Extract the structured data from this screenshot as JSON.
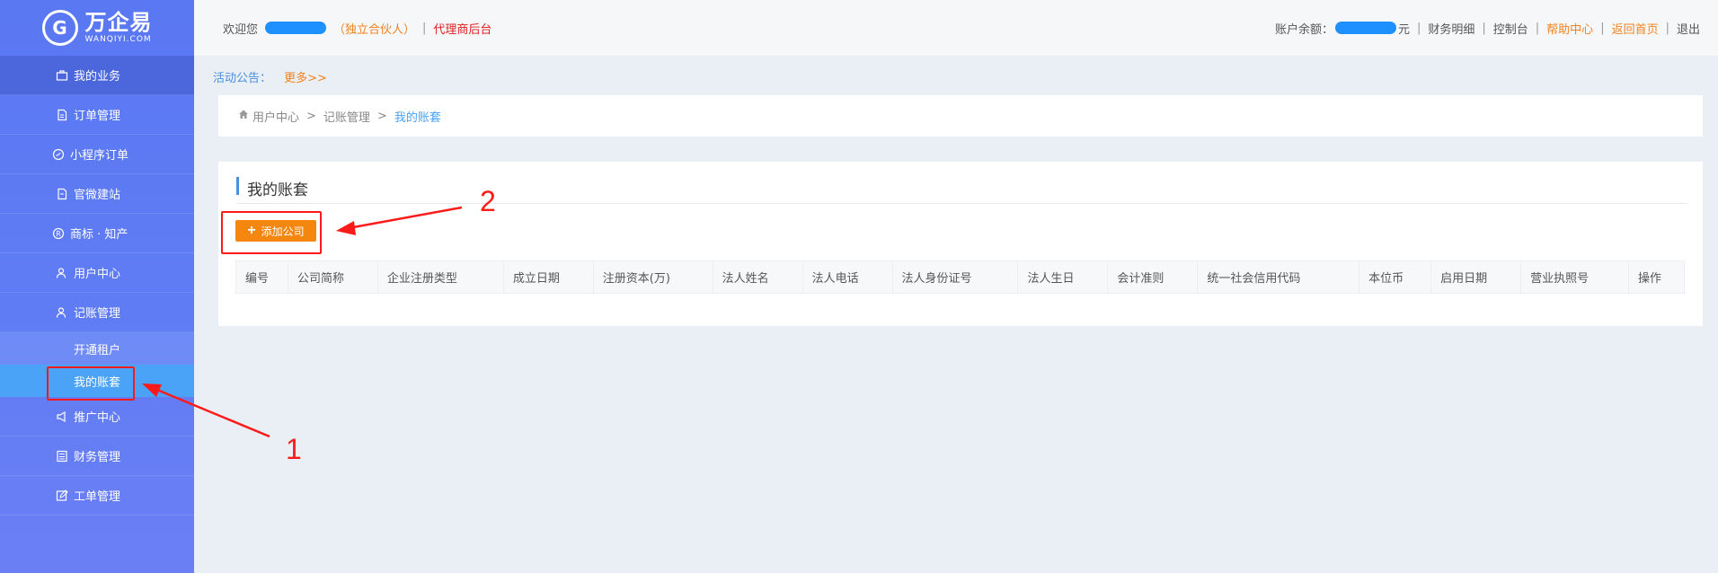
{
  "logo": {
    "name": "万企易",
    "sub": "WANQIYI.COM"
  },
  "sidebar": {
    "items": [
      {
        "label": "我的业务",
        "icon": "briefcase-icon"
      },
      {
        "label": "订单管理",
        "icon": "document-icon"
      },
      {
        "label": "小程序订单",
        "icon": "mini-program-icon"
      },
      {
        "label": "官微建站",
        "icon": "document-icon"
      },
      {
        "label": "商标 · 知产",
        "icon": "registered-icon"
      },
      {
        "label": "用户中心",
        "icon": "user-icon"
      },
      {
        "label": "记账管理",
        "icon": "user-icon"
      }
    ],
    "sub_items": [
      {
        "label": "开通租户"
      },
      {
        "label": "我的账套"
      }
    ],
    "items_after": [
      {
        "label": "推广中心",
        "icon": "megaphone-icon"
      },
      {
        "label": "财务管理",
        "icon": "calculator-icon"
      },
      {
        "label": "工单管理",
        "icon": "edit-icon"
      }
    ]
  },
  "topbar": {
    "welcome": "欢迎您",
    "role": "（独立合伙人）",
    "backend": "代理商后台",
    "balance_label": "账户余额：",
    "balance_unit": "元",
    "links": [
      "财务明细",
      "控制台",
      "帮助中心",
      "返回首页",
      "退出"
    ]
  },
  "notice": {
    "label": "活动公告：",
    "more": "更多>>"
  },
  "breadcrumb": {
    "items": [
      "用户中心",
      "记账管理",
      "我的账套"
    ],
    "separator": ">"
  },
  "main": {
    "title": "我的账套",
    "add_button": "添加公司",
    "columns": [
      "编号",
      "公司简称",
      "企业注册类型",
      "成立日期",
      "注册资本(万)",
      "法人姓名",
      "法人电话",
      "法人身份证号",
      "法人生日",
      "会计准则",
      "统一社会信用代码",
      "本位币",
      "启用日期",
      "营业执照号",
      "操作"
    ]
  },
  "annotations": {
    "n1": "1",
    "n2": "2"
  },
  "colors": {
    "accent": "#4a90e2",
    "orange": "#f5870f",
    "annotation": "#ff1a1a",
    "sidebar": "#5a78f2"
  }
}
